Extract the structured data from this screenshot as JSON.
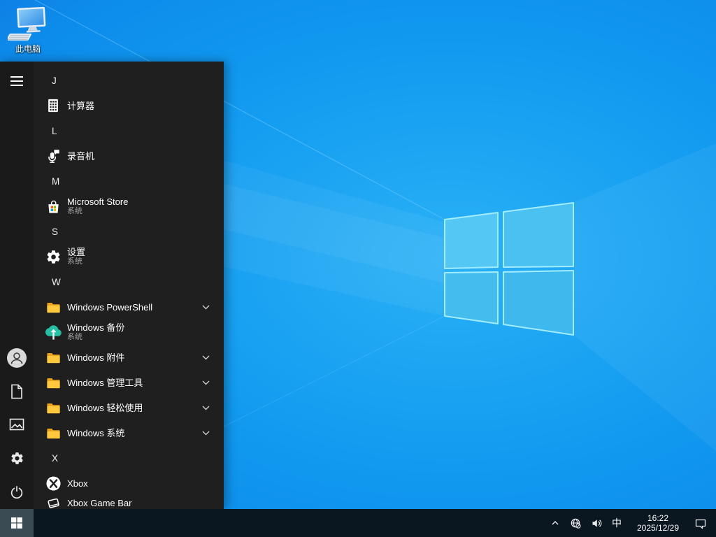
{
  "colors": {
    "menu_bg": "#1f1f1f",
    "rail_bg": "#1a1a1a",
    "taskbar_bg": "#0a1620",
    "start_button_bg": "#3b4b53",
    "subtitle_gray": "#a6a6a6",
    "folder_front": "#ffc83d",
    "folder_back": "#e7a11f",
    "backup_teal": "#26bfa3",
    "store_red": "#f25022",
    "store_green": "#7fba00",
    "store_blue": "#00a4ef",
    "store_yellow": "#ffb900",
    "logo_pane_blue": "#4cc3f2",
    "logo_edge_cyan": "#a9f1ff"
  },
  "desktop": {
    "this_pc": {
      "label": "此电脑"
    }
  },
  "start_menu": {
    "sections": [
      {
        "letter": "J",
        "items": [
          {
            "label": "计算器",
            "icon": "calculator"
          }
        ]
      },
      {
        "letter": "L",
        "items": [
          {
            "label": "录音机",
            "icon": "voice-recorder"
          }
        ]
      },
      {
        "letter": "M",
        "items": [
          {
            "label": "Microsoft Store",
            "subtitle": "系统",
            "icon": "microsoft-store"
          }
        ]
      },
      {
        "letter": "S",
        "items": [
          {
            "label": "设置",
            "subtitle": "系统",
            "icon": "settings-gear"
          }
        ]
      },
      {
        "letter": "W",
        "items": [
          {
            "label": "Windows PowerShell",
            "icon": "folder",
            "expandable": true
          },
          {
            "label": "Windows 备份",
            "subtitle": "系统",
            "icon": "cloud-backup"
          },
          {
            "label": "Windows 附件",
            "icon": "folder",
            "expandable": true
          },
          {
            "label": "Windows 管理工具",
            "icon": "folder",
            "expandable": true
          },
          {
            "label": "Windows 轻松使用",
            "icon": "folder",
            "expandable": true
          },
          {
            "label": "Windows 系统",
            "icon": "folder",
            "expandable": true
          }
        ]
      },
      {
        "letter": "X",
        "items": [
          {
            "label": "Xbox",
            "icon": "xbox"
          },
          {
            "label": "Xbox Game Bar",
            "icon": "xbox-game-bar"
          }
        ]
      }
    ]
  },
  "taskbar": {
    "tray": {
      "ime_indicator": "中",
      "time": "16:22",
      "date": "2025/12/29"
    }
  }
}
